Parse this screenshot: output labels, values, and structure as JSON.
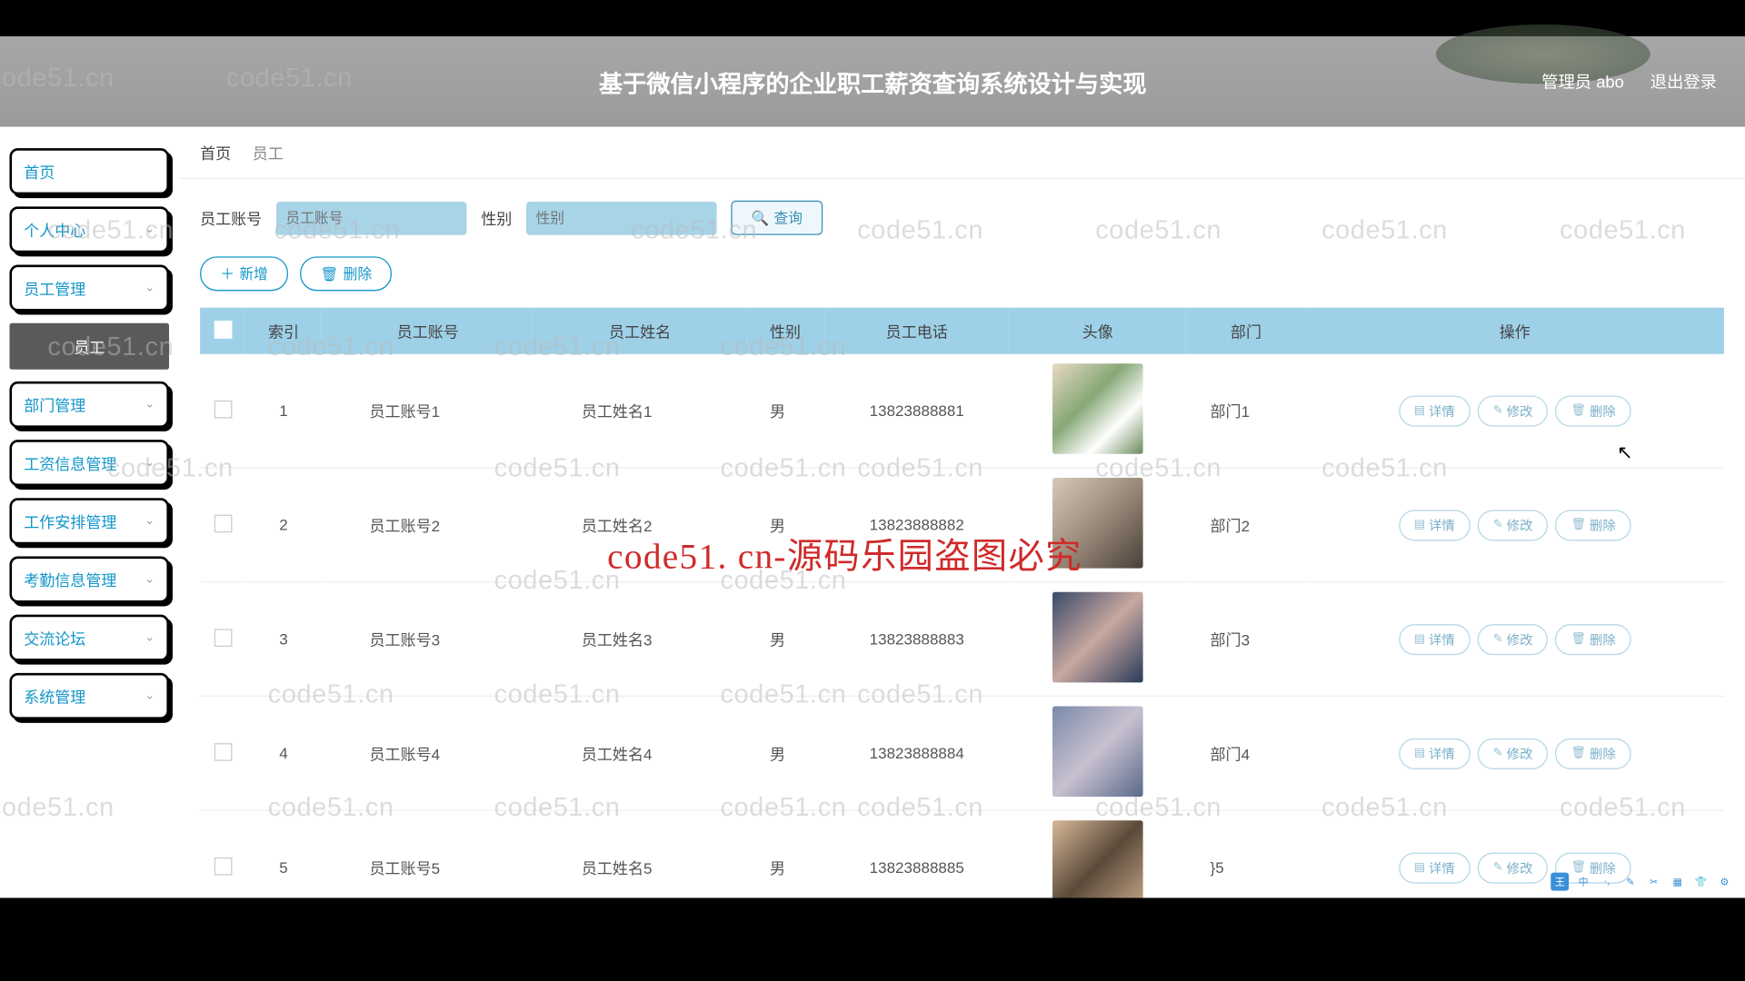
{
  "watermark": "code51.cn",
  "header": {
    "title": "基于微信小程序的企业职工薪资查询系统设计与实现",
    "admin_label": "管理员 abo",
    "logout_label": "退出登录"
  },
  "sidebar": {
    "items": [
      {
        "label": "首页",
        "expandable": false
      },
      {
        "label": "个人中心",
        "expandable": true
      },
      {
        "label": "员工管理",
        "expandable": true
      },
      {
        "label": "部门管理",
        "expandable": true
      },
      {
        "label": "工资信息管理",
        "expandable": true
      },
      {
        "label": "工作安排管理",
        "expandable": true
      },
      {
        "label": "考勤信息管理",
        "expandable": true
      },
      {
        "label": "交流论坛",
        "expandable": true
      },
      {
        "label": "系统管理",
        "expandable": true
      }
    ],
    "sub_item": "员工"
  },
  "breadcrumb": {
    "home": "首页",
    "current": "员工"
  },
  "filter": {
    "account_label": "员工账号",
    "account_placeholder": "员工账号",
    "gender_label": "性别",
    "gender_placeholder": "性别",
    "search_label": "查询"
  },
  "toolbar": {
    "add_label": "新增",
    "del_label": "删除"
  },
  "table": {
    "headers": [
      "",
      "索引",
      "员工账号",
      "员工姓名",
      "性别",
      "员工电话",
      "头像",
      "部门",
      "操作"
    ],
    "actions": {
      "detail": "详情",
      "edit": "修改",
      "delete": "删除"
    },
    "rows": [
      {
        "idx": "1",
        "account": "员工账号1",
        "name": "员工姓名1",
        "gender": "男",
        "phone": "13823888881",
        "dept": "部门1",
        "avclass": "av1"
      },
      {
        "idx": "2",
        "account": "员工账号2",
        "name": "员工姓名2",
        "gender": "男",
        "phone": "13823888882",
        "dept": "部门2",
        "avclass": "av2"
      },
      {
        "idx": "3",
        "account": "员工账号3",
        "name": "员工姓名3",
        "gender": "男",
        "phone": "13823888883",
        "dept": "部门3",
        "avclass": "av3"
      },
      {
        "idx": "4",
        "account": "员工账号4",
        "name": "员工姓名4",
        "gender": "男",
        "phone": "13823888884",
        "dept": "部门4",
        "avclass": "av4"
      },
      {
        "idx": "5",
        "account": "员工账号5",
        "name": "员工姓名5",
        "gender": "男",
        "phone": "13823888885",
        "dept": "}5",
        "avclass": "av5"
      }
    ]
  },
  "overlay": "code51. cn-源码乐园盗图必究",
  "colors": {
    "accent": "#1296c9",
    "table_header": "#9ed1e8",
    "input_bg": "#a8d4e8",
    "overlay": "#d02a2a"
  }
}
